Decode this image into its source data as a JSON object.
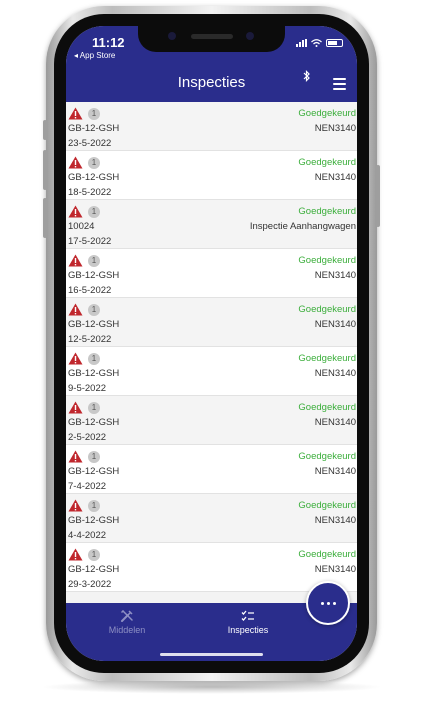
{
  "status_bar": {
    "time": "11:12",
    "back_label": "◂ App Store"
  },
  "header": {
    "title": "Inspecties"
  },
  "colors": {
    "primary": "#2a2d8c",
    "approved": "#3cae3c",
    "warning": "#c0272d"
  },
  "inspections": [
    {
      "count": "1",
      "id": "GB-12-GSH",
      "date": "23-5-2022",
      "status": "Goedgekeurd",
      "type": "NEN3140"
    },
    {
      "count": "1",
      "id": "GB-12-GSH",
      "date": "18-5-2022",
      "status": "Goedgekeurd",
      "type": "NEN3140"
    },
    {
      "count": "1",
      "id": "10024",
      "date": "17-5-2022",
      "status": "Goedgekeurd",
      "type": "Inspectie Aanhangwagen"
    },
    {
      "count": "1",
      "id": "GB-12-GSH",
      "date": "16-5-2022",
      "status": "Goedgekeurd",
      "type": "NEN3140"
    },
    {
      "count": "1",
      "id": "GB-12-GSH",
      "date": "12-5-2022",
      "status": "Goedgekeurd",
      "type": "NEN3140"
    },
    {
      "count": "1",
      "id": "GB-12-GSH",
      "date": "9-5-2022",
      "status": "Goedgekeurd",
      "type": "NEN3140"
    },
    {
      "count": "1",
      "id": "GB-12-GSH",
      "date": "2-5-2022",
      "status": "Goedgekeurd",
      "type": "NEN3140"
    },
    {
      "count": "1",
      "id": "GB-12-GSH",
      "date": "7-4-2022",
      "status": "Goedgekeurd",
      "type": "NEN3140"
    },
    {
      "count": "1",
      "id": "GB-12-GSH",
      "date": "4-4-2022",
      "status": "Goedgekeurd",
      "type": "NEN3140"
    },
    {
      "count": "1",
      "id": "GB-12-GSH",
      "date": "29-3-2022",
      "status": "Goedgekeurd",
      "type": "NEN3140"
    }
  ],
  "tabs": [
    {
      "label": "Middelen",
      "icon": "tools-icon",
      "active": false
    },
    {
      "label": "Inspecties",
      "icon": "checklist-icon",
      "active": true
    }
  ]
}
